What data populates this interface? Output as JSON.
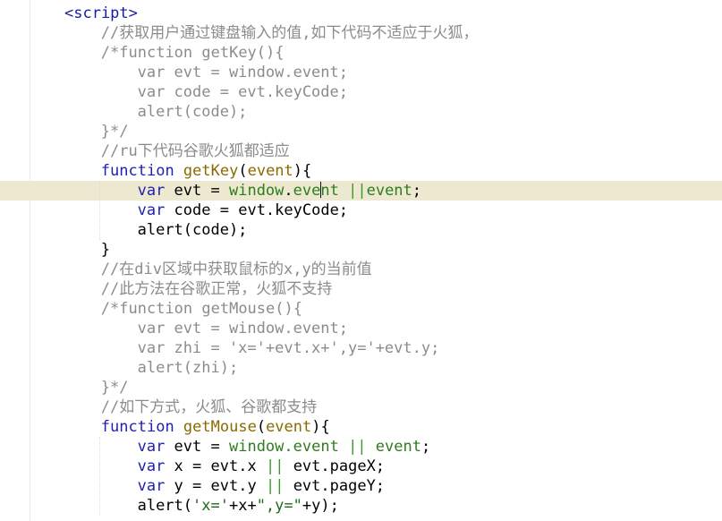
{
  "editor": {
    "language": "javascript",
    "colors": {
      "background": "#ffffff",
      "current_line": "#ece9d0",
      "keyword": "#1f1fb3",
      "function_name": "#8a6a00",
      "global_object": "#2f7c1f",
      "string": "#1d6b1d",
      "comment": "#8c8c8c"
    },
    "lines": [
      {
        "indent": 8,
        "tokens": [
          {
            "t": "<script>",
            "c": "tag"
          }
        ]
      },
      {
        "indent": 12,
        "tokens": [
          {
            "t": "//获取用户通过键盘输入的值,如下代码不适应于火狐，",
            "c": "cmc"
          }
        ]
      },
      {
        "indent": 12,
        "tokens": [
          {
            "t": "/*function getKey(){",
            "c": "cm"
          }
        ]
      },
      {
        "indent": 16,
        "tokens": [
          {
            "t": "var evt = window.event;",
            "c": "cm"
          }
        ]
      },
      {
        "indent": 16,
        "tokens": [
          {
            "t": "var code = evt.keyCode;",
            "c": "cm"
          }
        ]
      },
      {
        "indent": 16,
        "tokens": [
          {
            "t": "alert(code);",
            "c": "cm"
          }
        ]
      },
      {
        "indent": 12,
        "tokens": [
          {
            "t": "}*/",
            "c": "cm"
          }
        ]
      },
      {
        "indent": 12,
        "tokens": [
          {
            "t": "//ru下代码谷歌火狐都适应",
            "c": "cmc"
          }
        ]
      },
      {
        "indent": 12,
        "tokens": [
          {
            "t": "function ",
            "c": "kw"
          },
          {
            "t": "getKey",
            "c": "fn"
          },
          {
            "t": "(",
            "c": "op"
          },
          {
            "t": "event",
            "c": "fn"
          },
          {
            "t": "){",
            "c": "op"
          }
        ]
      },
      {
        "indent": 16,
        "current": true,
        "tokens": [
          {
            "t": "var ",
            "c": "kw"
          },
          {
            "t": "evt",
            "c": "id"
          },
          {
            "t": " = ",
            "c": "op"
          },
          {
            "t": "window",
            "c": "win"
          },
          {
            "t": ".",
            "c": "op"
          },
          {
            "t": "eve",
            "c": "win"
          },
          {
            "t": "",
            "c": "caret"
          },
          {
            "t": "nt",
            "c": "win"
          },
          {
            "t": " ",
            "c": "op"
          },
          {
            "t": "||",
            "c": "bar"
          },
          {
            "t": "event",
            "c": "win"
          },
          {
            "t": ";",
            "c": "op"
          }
        ]
      },
      {
        "indent": 16,
        "tokens": [
          {
            "t": "var ",
            "c": "kw"
          },
          {
            "t": "code",
            "c": "id"
          },
          {
            "t": " = ",
            "c": "op"
          },
          {
            "t": "evt.keyCode;",
            "c": "id"
          }
        ]
      },
      {
        "indent": 16,
        "tokens": [
          {
            "t": "alert(code);",
            "c": "id"
          }
        ]
      },
      {
        "indent": 12,
        "tokens": [
          {
            "t": "}",
            "c": "op"
          }
        ]
      },
      {
        "indent": 12,
        "tokens": [
          {
            "t": "//在div区域中获取鼠标的x,y的当前值",
            "c": "cmc"
          }
        ]
      },
      {
        "indent": 12,
        "tokens": [
          {
            "t": "//此方法在谷歌正常，火狐不支持",
            "c": "cmc"
          }
        ]
      },
      {
        "indent": 12,
        "tokens": [
          {
            "t": "/*function getMouse(){",
            "c": "cm"
          }
        ]
      },
      {
        "indent": 16,
        "tokens": [
          {
            "t": "var evt = window.event;",
            "c": "cm"
          }
        ]
      },
      {
        "indent": 16,
        "tokens": [
          {
            "t": "var zhi = 'x='+evt.x+',y='+evt.y;",
            "c": "cm"
          }
        ]
      },
      {
        "indent": 16,
        "tokens": [
          {
            "t": "alert(zhi);",
            "c": "cm"
          }
        ]
      },
      {
        "indent": 12,
        "tokens": [
          {
            "t": "}*/",
            "c": "cm"
          }
        ]
      },
      {
        "indent": 12,
        "tokens": [
          {
            "t": "//如下方式，火狐、谷歌都支持",
            "c": "cmc"
          }
        ]
      },
      {
        "indent": 12,
        "tokens": [
          {
            "t": "function ",
            "c": "kw"
          },
          {
            "t": "getMouse",
            "c": "fn"
          },
          {
            "t": "(",
            "c": "op"
          },
          {
            "t": "event",
            "c": "fn"
          },
          {
            "t": "){",
            "c": "op"
          }
        ]
      },
      {
        "indent": 16,
        "tokens": [
          {
            "t": "var ",
            "c": "kw"
          },
          {
            "t": "evt",
            "c": "id"
          },
          {
            "t": " = ",
            "c": "op"
          },
          {
            "t": "window.event",
            "c": "win"
          },
          {
            "t": " ",
            "c": "op"
          },
          {
            "t": "||",
            "c": "bar"
          },
          {
            "t": " ",
            "c": "op"
          },
          {
            "t": "event",
            "c": "win"
          },
          {
            "t": ";",
            "c": "op"
          }
        ]
      },
      {
        "indent": 16,
        "tokens": [
          {
            "t": "var ",
            "c": "kw"
          },
          {
            "t": "x",
            "c": "id"
          },
          {
            "t": " = ",
            "c": "op"
          },
          {
            "t": "evt.x",
            "c": "id"
          },
          {
            "t": " ",
            "c": "op"
          },
          {
            "t": "||",
            "c": "bar"
          },
          {
            "t": " ",
            "c": "op"
          },
          {
            "t": "evt.pageX;",
            "c": "id"
          }
        ]
      },
      {
        "indent": 16,
        "tokens": [
          {
            "t": "var ",
            "c": "kw"
          },
          {
            "t": "y",
            "c": "id"
          },
          {
            "t": " = ",
            "c": "op"
          },
          {
            "t": "evt.y",
            "c": "id"
          },
          {
            "t": " ",
            "c": "op"
          },
          {
            "t": "||",
            "c": "bar"
          },
          {
            "t": " ",
            "c": "op"
          },
          {
            "t": "evt.pageY;",
            "c": "id"
          }
        ]
      },
      {
        "indent": 16,
        "tokens": [
          {
            "t": "alert(",
            "c": "id"
          },
          {
            "t": "'x='",
            "c": "str"
          },
          {
            "t": "+x+",
            "c": "id"
          },
          {
            "t": "\",y=\"",
            "c": "str"
          },
          {
            "t": "+y);",
            "c": "id"
          }
        ]
      }
    ]
  }
}
